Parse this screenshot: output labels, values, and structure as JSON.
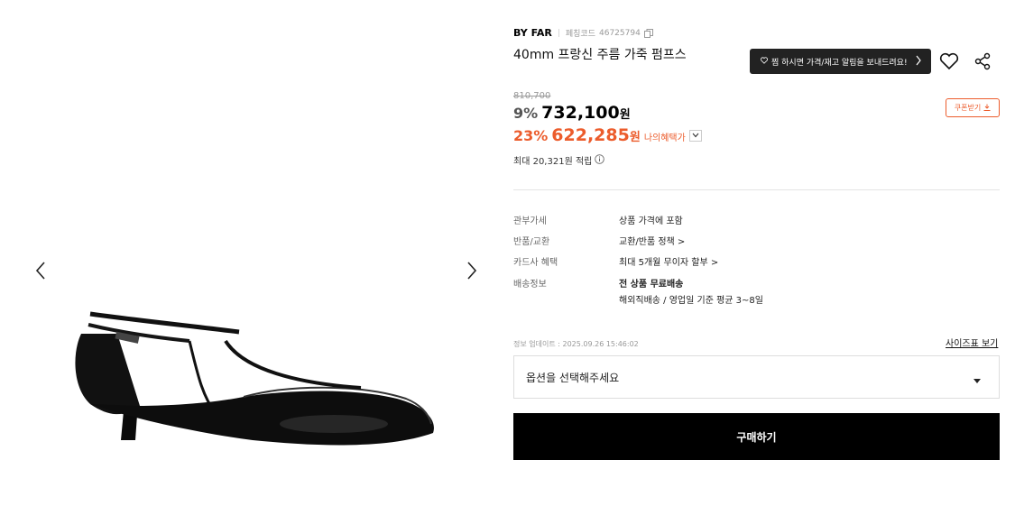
{
  "gallery": {
    "prev_icon": "chevron-left-icon",
    "next_icon": "chevron-right-icon",
    "image": "black-leather-kitten-heel-pump"
  },
  "product": {
    "brand": "BY FAR",
    "code_label": "페칭코드",
    "code_value": "46725794",
    "title": "40mm 프랑신 주름 가죽 펌프스"
  },
  "actions": {
    "notify_label": "찜 하시면 가격/재고 알림을 보내드려요!",
    "wish_icon": "heart-icon",
    "share_icon": "share-icon"
  },
  "pricing": {
    "original_price": "810,700",
    "discount_rate": "9%",
    "sale_price": "732,100",
    "currency": "원",
    "coupon_label": "쿠폰받기",
    "benefit_rate": "23%",
    "benefit_price": "622,285",
    "benefit_currency": "원",
    "benefit_label": "나의혜택가",
    "points_text": "최대 20,321원 적립",
    "accent_color": "#ec5c2c"
  },
  "specs": [
    {
      "label": "관부가세",
      "value": "상품 가격에 포함"
    },
    {
      "label": "반품/교환",
      "value": "교환/반품 정책 >"
    },
    {
      "label": "카드사 혜택",
      "value": "최대 5개월 무이자 할부 >"
    },
    {
      "label": "배송정보",
      "value": "전 상품 무료배송",
      "sub_value": "해외직배송 / 영업일 기준 평균 3~8일"
    }
  ],
  "meta": {
    "update_time": "정보 업데이트 : 2025.09.26 15:46:02",
    "size_chart": "사이즈표 보기"
  },
  "purchase": {
    "option_placeholder": "옵션을 선택해주세요",
    "buy_label": "구매하기"
  }
}
